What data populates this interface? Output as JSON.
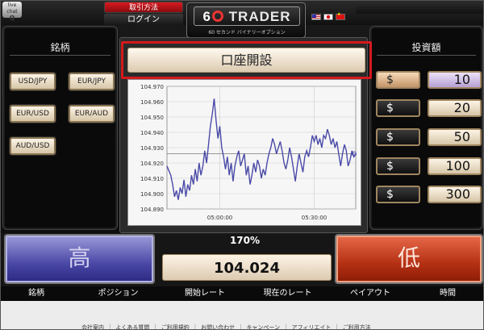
{
  "header": {
    "live_chat": "live chat",
    "live_chat_q": "Q",
    "how_to_trade": "取引方法",
    "login": "ログイン",
    "logo_text": "TRADER",
    "logo_sub": "60 セカンド バイナリーオプション",
    "flags": [
      "us-flag",
      "jp-flag",
      "cn-flag"
    ]
  },
  "left_panel": {
    "title": "銘柄",
    "pairs": [
      "USD/JPY",
      "EUR/JPY",
      "EUR/USD",
      "EUR/AUD",
      "AUD/USD"
    ]
  },
  "right_panel": {
    "title": "投資額",
    "currency": "$",
    "amounts": [
      "10",
      "20",
      "50",
      "100",
      "300"
    ],
    "selected_amount": "10"
  },
  "open_account_label": "口座開設",
  "chart_data": {
    "type": "line",
    "title": "",
    "xlabel": "",
    "ylabel": "",
    "ylim": [
      104.89,
      104.97
    ],
    "y_ticks": [
      "104.970",
      "104.960",
      "104.950",
      "104.940",
      "104.930",
      "104.920",
      "104.910",
      "104.900",
      "104.890"
    ],
    "x_ticks": [
      {
        "label": "05:00:00",
        "t": 0.28
      },
      {
        "label": "05:30:00",
        "t": 0.78
      }
    ],
    "series": [
      {
        "color": "#4a4aa8",
        "t": [
          0.0,
          0.02,
          0.03,
          0.04,
          0.05,
          0.06,
          0.07,
          0.08,
          0.09,
          0.1,
          0.11,
          0.12,
          0.13,
          0.14,
          0.15,
          0.16,
          0.17,
          0.18,
          0.19,
          0.2,
          0.21,
          0.22,
          0.23,
          0.24,
          0.25,
          0.26,
          0.27,
          0.28,
          0.29,
          0.3,
          0.31,
          0.32,
          0.33,
          0.34,
          0.35,
          0.36,
          0.37,
          0.38,
          0.39,
          0.4,
          0.41,
          0.42,
          0.43,
          0.44,
          0.45,
          0.46,
          0.47,
          0.48,
          0.49,
          0.5,
          0.51,
          0.52,
          0.53,
          0.54,
          0.55,
          0.56,
          0.57,
          0.58,
          0.59,
          0.6,
          0.61,
          0.62,
          0.63,
          0.64,
          0.65,
          0.66,
          0.67,
          0.68,
          0.69,
          0.7,
          0.71,
          0.72,
          0.73,
          0.74,
          0.75,
          0.76,
          0.77,
          0.78,
          0.79,
          0.8,
          0.81,
          0.82,
          0.83,
          0.84,
          0.85,
          0.86,
          0.87,
          0.88,
          0.89,
          0.9,
          0.91,
          0.92,
          0.93,
          0.94,
          0.95,
          0.96,
          0.97,
          0.98,
          0.99,
          1.0
        ],
        "values": [
          104.918,
          104.912,
          104.906,
          104.898,
          104.902,
          104.896,
          104.904,
          104.9,
          104.909,
          104.898,
          104.906,
          104.902,
          104.912,
          104.906,
          104.916,
          104.908,
          104.92,
          104.912,
          104.918,
          104.928,
          104.92,
          104.932,
          104.944,
          104.952,
          104.962,
          104.948,
          104.936,
          104.944,
          104.93,
          104.924,
          104.916,
          104.924,
          104.912,
          104.92,
          104.908,
          104.918,
          104.924,
          104.928,
          104.918,
          104.922,
          104.926,
          104.912,
          104.918,
          104.906,
          104.912,
          104.92,
          104.914,
          104.922,
          104.918,
          104.91,
          104.916,
          104.912,
          104.92,
          104.926,
          104.93,
          104.936,
          104.932,
          104.926,
          104.93,
          104.934,
          104.928,
          104.92,
          104.916,
          104.922,
          104.93,
          104.924,
          104.916,
          104.908,
          104.918,
          104.926,
          104.92,
          104.914,
          104.924,
          104.928,
          104.924,
          104.93,
          104.938,
          104.934,
          104.938,
          104.932,
          104.936,
          104.93,
          104.938,
          104.936,
          104.942,
          104.938,
          104.932,
          104.936,
          104.93,
          104.934,
          104.926,
          104.918,
          104.926,
          104.932,
          104.928,
          104.918,
          104.922,
          104.928,
          104.924,
          104.926
        ]
      }
    ],
    "reference_line": 104.926,
    "grid": true
  },
  "trade": {
    "high_label": "高",
    "low_label": "低",
    "payout_pct": "170%",
    "current_rate": "104.024"
  },
  "columns": [
    "銘柄",
    "ポジション",
    "開始レート",
    "現在のレート",
    "ペイアウト",
    "時間"
  ],
  "footer_links": [
    "会社案内",
    "よくある質問",
    "ご利用規約",
    "お問い合わせ",
    "キャンペーン",
    "アフィリエイト",
    "ご利用方法"
  ]
}
